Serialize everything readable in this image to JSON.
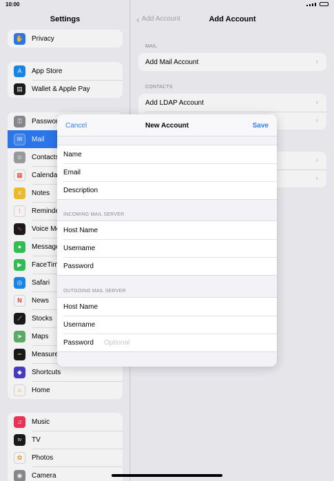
{
  "status_bar": {
    "time": "10:00"
  },
  "sidebar": {
    "title": "Settings",
    "groups": [
      [
        {
          "label": "Privacy",
          "icon": "hand-icon",
          "color": "#2f7cf6"
        }
      ],
      [
        {
          "label": "App Store",
          "icon": "app-store-icon",
          "color": "#1a8cf0"
        },
        {
          "label": "Wallet & Apple Pay",
          "icon": "wallet-icon",
          "color": "#1c1c1e"
        }
      ],
      [
        {
          "label": "Passwords",
          "icon": "key-icon",
          "color": "#8e8e93"
        },
        {
          "label": "Mail",
          "icon": "mail-icon",
          "color": "#2f7cf6"
        },
        {
          "label": "Contacts",
          "icon": "contacts-icon",
          "color": "#a2a2a6"
        },
        {
          "label": "Calendar",
          "icon": "calendar-icon",
          "color": "#ffffff"
        },
        {
          "label": "Notes",
          "icon": "notes-icon",
          "color": "#f7c531"
        },
        {
          "label": "Reminders",
          "icon": "reminders-icon",
          "color": "#ffffff"
        },
        {
          "label": "Voice Memos",
          "icon": "voice-memos-icon",
          "color": "#1c1c1e"
        },
        {
          "label": "Messages",
          "icon": "messages-icon",
          "color": "#34c759"
        },
        {
          "label": "FaceTime",
          "icon": "facetime-icon",
          "color": "#34c759"
        },
        {
          "label": "Safari",
          "icon": "safari-icon",
          "color": "#1a8cf0"
        },
        {
          "label": "News",
          "icon": "news-icon",
          "color": "#ffffff"
        },
        {
          "label": "Stocks",
          "icon": "stocks-icon",
          "color": "#1c1c1e"
        },
        {
          "label": "Maps",
          "icon": "maps-icon",
          "color": "#5fb56a"
        },
        {
          "label": "Measure",
          "icon": "measure-icon",
          "color": "#1c1c1e"
        },
        {
          "label": "Shortcuts",
          "icon": "shortcuts-icon",
          "color": "#4b3fc9"
        },
        {
          "label": "Home",
          "icon": "home-icon",
          "color": "#ffffff"
        }
      ],
      [
        {
          "label": "Music",
          "icon": "music-icon",
          "color": "#f5365c"
        },
        {
          "label": "TV",
          "icon": "tv-icon",
          "color": "#1c1c1e"
        },
        {
          "label": "Photos",
          "icon": "photos-icon",
          "color": "#ffffff"
        },
        {
          "label": "Camera",
          "icon": "camera-icon",
          "color": "#8e8e93"
        }
      ]
    ],
    "active": "Mail"
  },
  "detail": {
    "back_label": "Add Account",
    "title": "Add Account",
    "mail_header": "MAIL",
    "mail_row": "Add Mail Account",
    "contacts_header": "CONTACTS",
    "contacts_row": "Add LDAP Account"
  },
  "modal": {
    "cancel": "Cancel",
    "title": "New Account",
    "save": "Save",
    "account_fields": [
      "Name",
      "Email",
      "Description"
    ],
    "incoming_header": "INCOMING MAIL SERVER",
    "incoming_fields": [
      "Host Name",
      "Username",
      "Password"
    ],
    "outgoing_header": "OUTGOING MAIL SERVER",
    "outgoing_fields": [
      "Host Name",
      "Username",
      "Password"
    ],
    "outgoing_password_placeholder": "Optional"
  },
  "colors": {
    "accent": "#2f7cf6",
    "background": "#f2f2f7"
  }
}
